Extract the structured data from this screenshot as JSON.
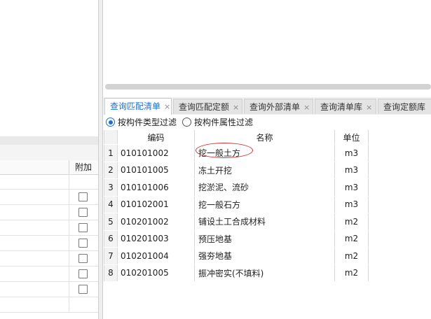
{
  "left_panel": {
    "column_header": "附加",
    "checkbox_rows": [
      false,
      false,
      false,
      false,
      false,
      false,
      false
    ],
    "empty_rows": 2
  },
  "tabs": [
    {
      "label": "查询匹配清单",
      "close": "×",
      "active": true
    },
    {
      "label": "查询匹配定额",
      "close": "×",
      "active": false
    },
    {
      "label": "查询外部清单",
      "close": "×",
      "active": false
    },
    {
      "label": "查询清单库",
      "close": "×",
      "active": false
    },
    {
      "label": "查询定额库",
      "close": "",
      "active": false
    }
  ],
  "filter": {
    "option_type": "按构件类型过滤",
    "option_attr": "按构件属性过滤",
    "selected": "type"
  },
  "table": {
    "headers": {
      "code": "编码",
      "name": "名称",
      "unit": "单位"
    },
    "rows": [
      {
        "no": "1",
        "code": "010101002",
        "name": "挖一般土方",
        "unit": "m3"
      },
      {
        "no": "2",
        "code": "010101005",
        "name": "冻土开挖",
        "unit": "m3"
      },
      {
        "no": "3",
        "code": "010101006",
        "name": "挖淤泥、流砂",
        "unit": "m3"
      },
      {
        "no": "4",
        "code": "010102001",
        "name": "挖一般石方",
        "unit": "m3"
      },
      {
        "no": "5",
        "code": "010201002",
        "name": "铺设土工合成材料",
        "unit": "m2"
      },
      {
        "no": "6",
        "code": "010201003",
        "name": "预压地基",
        "unit": "m2"
      },
      {
        "no": "7",
        "code": "010201004",
        "name": "强夯地基",
        "unit": "m2"
      },
      {
        "no": "8",
        "code": "010201005",
        "name": "振冲密实(不填料)",
        "unit": "m2"
      }
    ]
  },
  "colors": {
    "accent": "#1f6fd1",
    "annotation": "#d32f2f"
  }
}
